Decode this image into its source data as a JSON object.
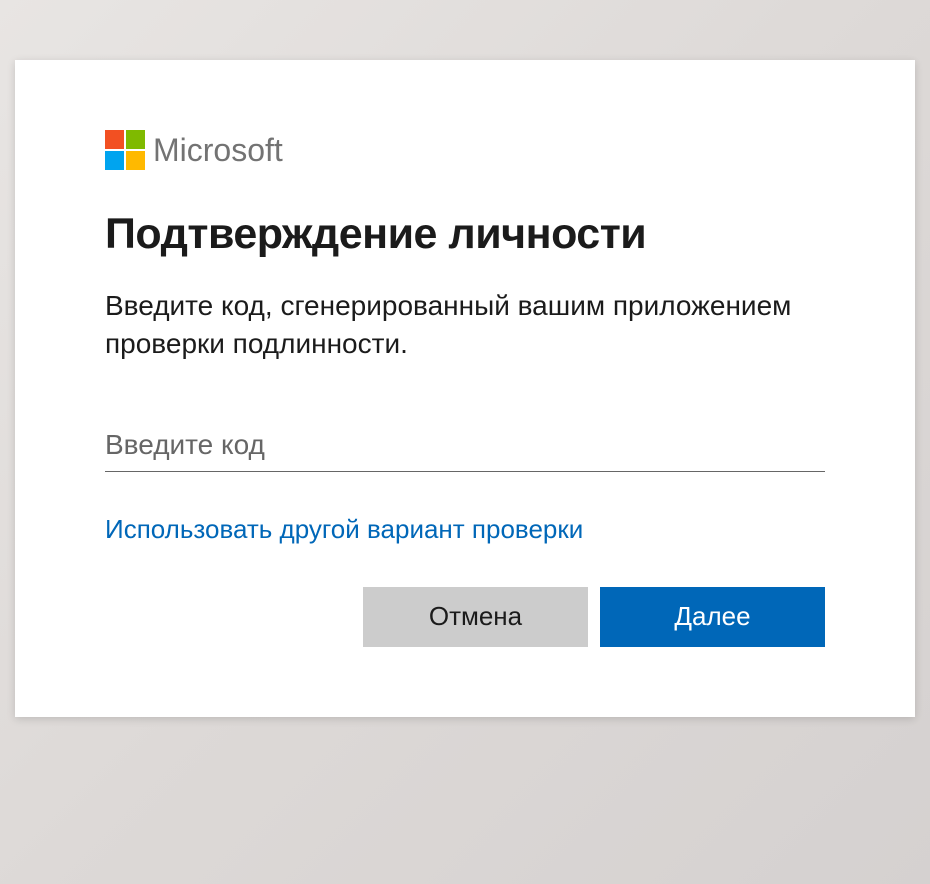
{
  "brand": {
    "name": "Microsoft"
  },
  "dialog": {
    "title": "Подтверждение личности",
    "description": "Введите код, сгенерированный вашим приложением проверки подлинности.",
    "input_placeholder": "Введите код",
    "alt_link": "Использовать другой вариант проверки",
    "cancel_label": "Отмена",
    "next_label": "Далее"
  },
  "colors": {
    "primary": "#0067b8",
    "secondary_button": "#cccccc",
    "ms_red": "#f25022",
    "ms_green": "#7fba00",
    "ms_blue": "#00a4ef",
    "ms_yellow": "#ffb900"
  }
}
